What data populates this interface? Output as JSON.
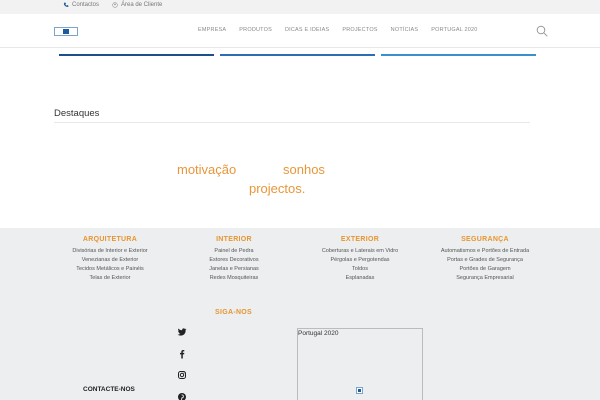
{
  "topbar": {
    "phone_label": "Contactos",
    "client_label": "Área de Cliente"
  },
  "nav": {
    "items": [
      "EMPRESA",
      "PRODUTOS",
      "DICAS E IDEIAS",
      "PROJECTOS",
      "NOTÍCIAS",
      "PORTUGAL 2020"
    ]
  },
  "highlights": {
    "title": "Destaques"
  },
  "slogan": {
    "word1": "motivação",
    "word2": "sonhos",
    "word3": "projectos."
  },
  "footer": {
    "columns": [
      {
        "title": "ARQUITETURA",
        "items": [
          "Divisórias de Interior e Exterior",
          "Venezianas de Exterior",
          "Tecidos Metálicos e Painéis",
          "Telas de Exterior"
        ]
      },
      {
        "title": "INTERIOR",
        "items": [
          "Painel de Pedra",
          "Estores Decorativos",
          "Janelas e Persianas",
          "Redes Mosquiteiras"
        ]
      },
      {
        "title": "EXTERIOR",
        "items": [
          "Coberturas e Laterais em Vidro",
          "Pérgolas e Pergotendas",
          "Toldos",
          "Esplanadas"
        ]
      },
      {
        "title": "SEGURANÇA",
        "items": [
          "Automatismos e Portões de Entrada",
          "Portas e Grades de Segurança",
          "Portões de Garagem",
          "Segurança Empresarial"
        ]
      }
    ],
    "follow_title": "SIGA-NOS",
    "contact_title": "CONTACTE-NOS",
    "portugal_label": "Portugal 2020"
  },
  "colors": {
    "accent": "#e8952f",
    "bar1": "#1f4e8c",
    "bar2": "#2a6fb5",
    "bar3": "#3a8fd0",
    "footer_bg": "#eceeef"
  }
}
